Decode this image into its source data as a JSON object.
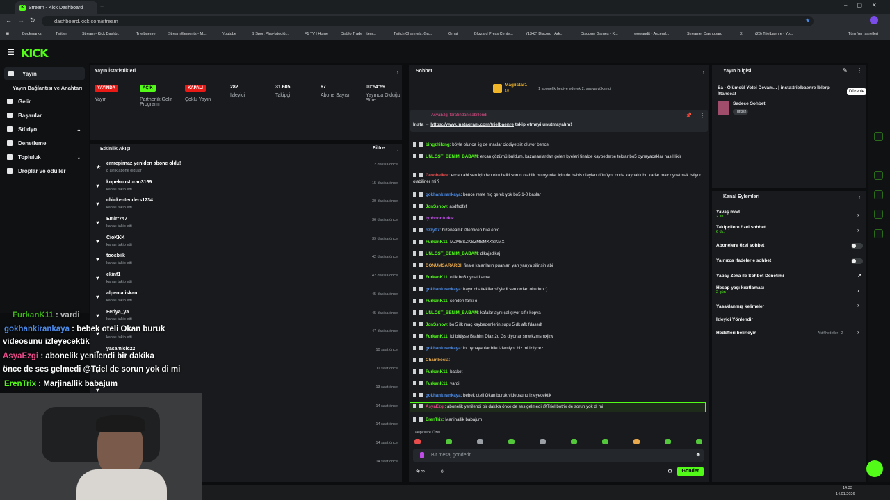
{
  "browser": {
    "tab_title": "Stream - Kick Dashboard",
    "url": "dashboard.kick.com/stream",
    "bookmarks": [
      "Bookmarks",
      "Twitter",
      "Stream - Kick Dashb..",
      "Trielbaenre",
      "StreamElements - M...",
      "Youtube",
      "S Sport Plus-İstediği...",
      "F1 TV | Home",
      "Diablo Trade | Item...",
      "Twitch Channels, Ga...",
      "Gmail",
      "Blizzard Press Cente...",
      "(1342) Discord | Ark...",
      "Discover Games - K...",
      "wowaudit - Ascend...",
      "Streamer Dashboard",
      "X",
      "(23) Trielbaenre - Yo...",
      "Tüm Yer İşaretleri"
    ]
  },
  "logo": "KICK",
  "sidebar": {
    "items": [
      {
        "label": "Yayın"
      },
      {
        "label": "Yayın Bağlantısı ve Anahtarı"
      },
      {
        "label": "Gelir"
      },
      {
        "label": "Başarılar"
      },
      {
        "label": "Stüdyo"
      },
      {
        "label": "Denetleme"
      },
      {
        "label": "Topluluk"
      },
      {
        "label": "Droplar ve ödüller"
      }
    ]
  },
  "stats": {
    "title": "Yayın İstatistikleri",
    "items": [
      {
        "badge": "YAYINDA",
        "label": "Yayın"
      },
      {
        "badge": "AÇIK",
        "label": "Partnerlik Gelir Programı"
      },
      {
        "badge": "KAPALI",
        "label": "Çoklu Yayın"
      },
      {
        "value": "282",
        "label": "İzleyici"
      },
      {
        "value": "31.605",
        "label": "Takipçi"
      },
      {
        "value": "67",
        "label": "Abone Sayısı"
      },
      {
        "value": "00:54:59",
        "label": "Yayında Olduğu Süre"
      }
    ]
  },
  "feed": {
    "title": "Etkinlik Akışı",
    "filter": "Filtre",
    "items": [
      {
        "name": "emrepirnaz yeniden abone oldu!",
        "sub": "8 aylık abone oldular",
        "time": "2 dakika önce"
      },
      {
        "name": "kopekcosturan3169",
        "sub": "kanalı takip etti",
        "time": "15 dakika önce"
      },
      {
        "name": "chickentenders1234",
        "sub": "kanalı takip etti",
        "time": "30 dakika önce"
      },
      {
        "name": "Emirr747",
        "sub": "kanalı takip etti",
        "time": "36 dakika önce"
      },
      {
        "name": "CioKKK",
        "sub": "kanalı takip etti",
        "time": "39 dakika önce"
      },
      {
        "name": "toosbiik",
        "sub": "kanalı takip etti",
        "time": "42 dakika önce"
      },
      {
        "name": "ekinf1",
        "sub": "kanalı takip etti",
        "time": "42 dakika önce"
      },
      {
        "name": "alpercaliskan",
        "sub": "kanalı takip etti",
        "time": "45 dakika önce"
      },
      {
        "name": "Feriya_ya",
        "sub": "kanalı takip etti",
        "time": "45 dakika önce"
      },
      {
        "name": "",
        "sub": "kanalı takip etti",
        "time": "47 dakika önce"
      },
      {
        "name": "yasamicic22",
        "sub": "",
        "time": "10 saat önce"
      },
      {
        "name": "",
        "sub": "",
        "time": "11 saat önce"
      },
      {
        "name": "",
        "sub": "",
        "time": "13 saat önce"
      },
      {
        "name": "",
        "sub": "",
        "time": "14 saat önce"
      },
      {
        "name": "",
        "sub": "",
        "time": "14 saat önce"
      },
      {
        "name": "",
        "sub": "",
        "time": "14 saat önce"
      },
      {
        "name": "",
        "sub": "",
        "time": "14 saat önce"
      }
    ]
  },
  "chat": {
    "title": "Sohbet",
    "gifter": "Magiistar1",
    "gifter_count": "10",
    "gift_text": "1 abonelik hediye ederek 2. sıraya yükseldi",
    "pinned_by": "AsyaEzgi tarafından sabitlendi",
    "pinned_msg_prefix": "Insta → ",
    "pinned_link": "https://www.instagram.com/trielbaenre",
    "pinned_msg_suffix": " takip etmeyi unutmayalım!",
    "messages": [
      {
        "user": "bingzhilong",
        "color": "#53fc18",
        "text": "böyle olunca lig de maçlar ciddiyetsiz oluyor bence"
      },
      {
        "user": "UNLOST_BENIM_BABAM",
        "color": "#53fc18",
        "text": "ercan çözümü buldum. kazananlardan gelen byeleri finalde kaybedersе tekrar bo5 oynayacaklar nasıl likir"
      },
      {
        "user": "Groobelkor",
        "color": "#e84c4c",
        "text": "ercan abi sen içinden oku belki sorun olabilir bu oyunlar için de bahis olayları dönüyor onda kaynaklı bu kadar maç oynatmak istiyor olabilirler mi ?"
      },
      {
        "user": "gokhankirankaya",
        "color": "#4c8be8",
        "text": "bence reste hiç gerek yok bo5 1-0 başlar"
      },
      {
        "user": "JonSsnow",
        "color": "#53fc18",
        "text": "asdfsdfsf"
      },
      {
        "user": "typhoonturks",
        "color": "#c04ce8",
        "text": ""
      },
      {
        "user": "ozzy07",
        "color": "#4c8be8",
        "text": "bizeneamk izlemicen bile erco"
      },
      {
        "user": "FurkanK11",
        "color": "#53fc18",
        "text": "MZMSSZKSZMSMXKSKMX"
      },
      {
        "user": "UNLOST_BENIM_BABAM",
        "color": "#53fc18",
        "text": "dlkajsdlkaj"
      },
      {
        "user": "DONUMSARARDI",
        "color": "#e8a94c",
        "text": "finale kalanların puanları yarı yarıya silinsin abi"
      },
      {
        "user": "FurkanK11",
        "color": "#53fc18",
        "text": "o ilk bo3 oynatti ama"
      },
      {
        "user": "gokhankirankaya",
        "color": "#4c8be8",
        "text": "hayır chattekiler söyledi sen ordan okudun :)"
      },
      {
        "user": "FurkanK11",
        "color": "#53fc18",
        "text": "senden farkı o"
      },
      {
        "user": "UNLOST_BENIM_BABAM",
        "color": "#53fc18",
        "text": "kafalar aynı çalışıyor sıfır kopya"
      },
      {
        "user": "JonSsnow",
        "color": "#53fc18",
        "text": "bo 5 ilk maç kaybedenlerin supu 5 dk afk fdassdf"
      },
      {
        "user": "FurkanK11",
        "color": "#53fc18",
        "text": "lol bittiyse Brahim Diaz 2u Gs diyorlar smwkzmsmxjkw"
      },
      {
        "user": "gokhankirankaya",
        "color": "#4c8be8",
        "text": "lol oynayanlar bile izlemiyor biz mi izliycez"
      },
      {
        "user": "Chambocia",
        "color": "#e8a94c",
        "text": ""
      },
      {
        "user": "FurkanK11",
        "color": "#53fc18",
        "text": "basket"
      },
      {
        "user": "FurkanK11",
        "color": "#53fc18",
        "text": "vardi"
      },
      {
        "user": "gokhankirankaya",
        "color": "#4c8be8",
        "text": "bebek oteli Okan buruk videosunu izleyecektik"
      },
      {
        "user": "AsyaEzgi",
        "color": "#e84c8b",
        "text": "abonelik yenilendi bir dakika önce de ses gelmedi @Triel botrix de sorun yok di mi"
      },
      {
        "user": "ErenTrix",
        "color": "#53fc18",
        "text": "Marjinallik babajum"
      }
    ],
    "followers_only": "Takipçilere Özel",
    "placeholder": "Bir mesaj gönderin",
    "points": "0",
    "send": "Gönder"
  },
  "info": {
    "title": "Yayın bilgisi",
    "stream_title": "Sa - Ölümcül Yotei Devam... | insta:trielbaenre İblerp İttanseat",
    "category": "Sadece Sohbet",
    "lang": "Türkish",
    "edit_tooltip": "Düzenle"
  },
  "actions": {
    "title": "Kanal Eylemleri",
    "items": [
      {
        "label": "Yavaş mod",
        "sub": "2 sn."
      },
      {
        "label": "Takipçilere özel sohbet",
        "sub": "6 dk."
      },
      {
        "label": "Abonelere özel sohbet",
        "sub": ""
      },
      {
        "label": "Yalnızca ifadelerle sohbet",
        "sub": ""
      },
      {
        "label": "Yapay Zeka ile Sohbet Denetimi",
        "sub": ""
      },
      {
        "label": "Hesap yaşı kısıtlaması",
        "sub": "2 gün"
      },
      {
        "label": "Yasaklanmış kelimeler",
        "sub": ""
      },
      {
        "label": "İzleyici Yönlendir",
        "sub": ""
      },
      {
        "label": "Hedefleri belirleyin",
        "sub": ""
      }
    ],
    "goals_status": "Aktif hedefler - 2"
  },
  "overlay": {
    "lines": [
      {
        "user": "FurkanK11",
        "text": " : vardi"
      },
      {
        "user": "gokhankirankaya",
        "text": " : bebek oteli Okan buruk"
      },
      {
        "user": "",
        "text": "videosunu izleyecektik"
      },
      {
        "user": "AsyaEzgi",
        "text": " : abonelik yenilendi bir dakika"
      },
      {
        "user": "",
        "text": "önce de ses gelmedi @Triel   de sorun yok di mi"
      },
      {
        "user": "ErenTrix",
        "text": " : Marjinallik babajum"
      }
    ]
  },
  "taskbar": {
    "time": "14:33",
    "date": "14.01.2026"
  },
  "colors": {
    "accent": "#53fc18",
    "live": "#e91916",
    "bg": "#0b0d0f",
    "panel": "#181a1d"
  }
}
